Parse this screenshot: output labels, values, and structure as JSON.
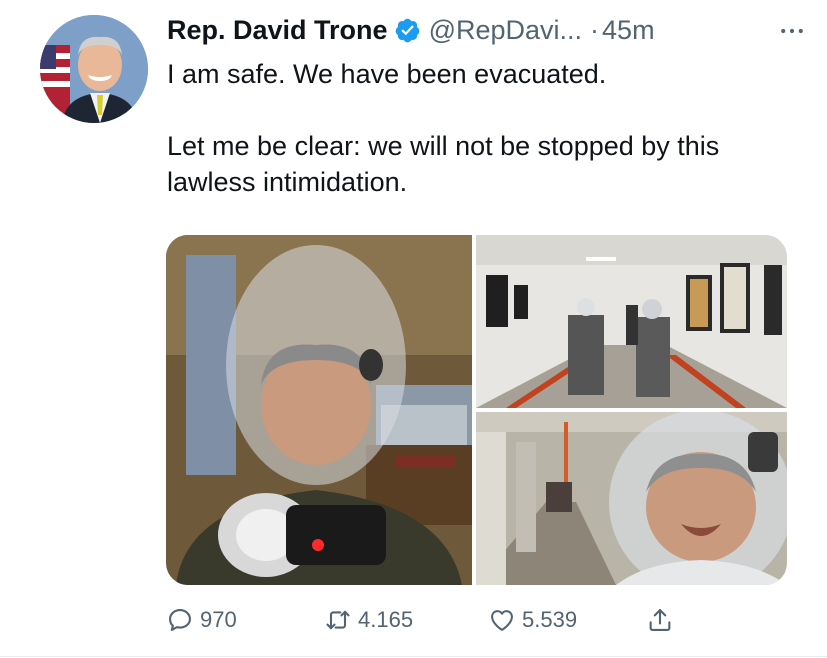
{
  "author": {
    "display_name": "Rep. David Trone",
    "handle": "@RepDavi...",
    "separator": "·",
    "timestamp": "45m",
    "verified": true
  },
  "tweet": {
    "paragraphs": [
      "I am safe. We have been evacuated.",
      "Let me be clear: we will not be stopped by this lawless intimidation."
    ]
  },
  "media": [
    {
      "icon": "photo-selfie-hood"
    },
    {
      "icon": "photo-hallway-evacuation"
    },
    {
      "icon": "photo-selfie-tunnel"
    }
  ],
  "actions": {
    "reply_count": "970",
    "retweet_count": "4.165",
    "like_count": "5.539"
  },
  "colors": {
    "verified_blue": "#1d9bf0",
    "secondary_text": "#536471",
    "primary_text": "#0f1419"
  }
}
